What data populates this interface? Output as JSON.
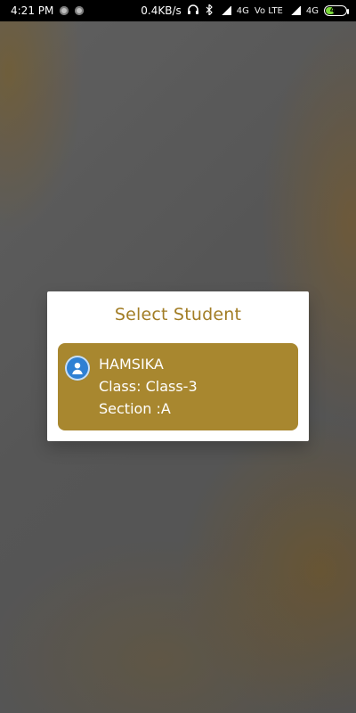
{
  "status_bar": {
    "time": "4:21 PM",
    "speed": "0.4KB/s",
    "network1": "4G",
    "volte": "Vo LTE",
    "network2": "4G",
    "battery": "44",
    "battery_percent": 44
  },
  "dialog": {
    "title": "Select Student",
    "student": {
      "name": "HAMSIKA",
      "class_line": "Class: Class-3",
      "section_line": "Section :A"
    }
  },
  "colors": {
    "accent": "#a8872f",
    "title": "#a27d25",
    "avatar": "#2f80d3"
  },
  "icons": {
    "avatar": "user-icon",
    "headphones": "headphones-icon",
    "bluetooth": "bluetooth-icon",
    "signal": "signal-icon",
    "battery": "battery-icon"
  }
}
